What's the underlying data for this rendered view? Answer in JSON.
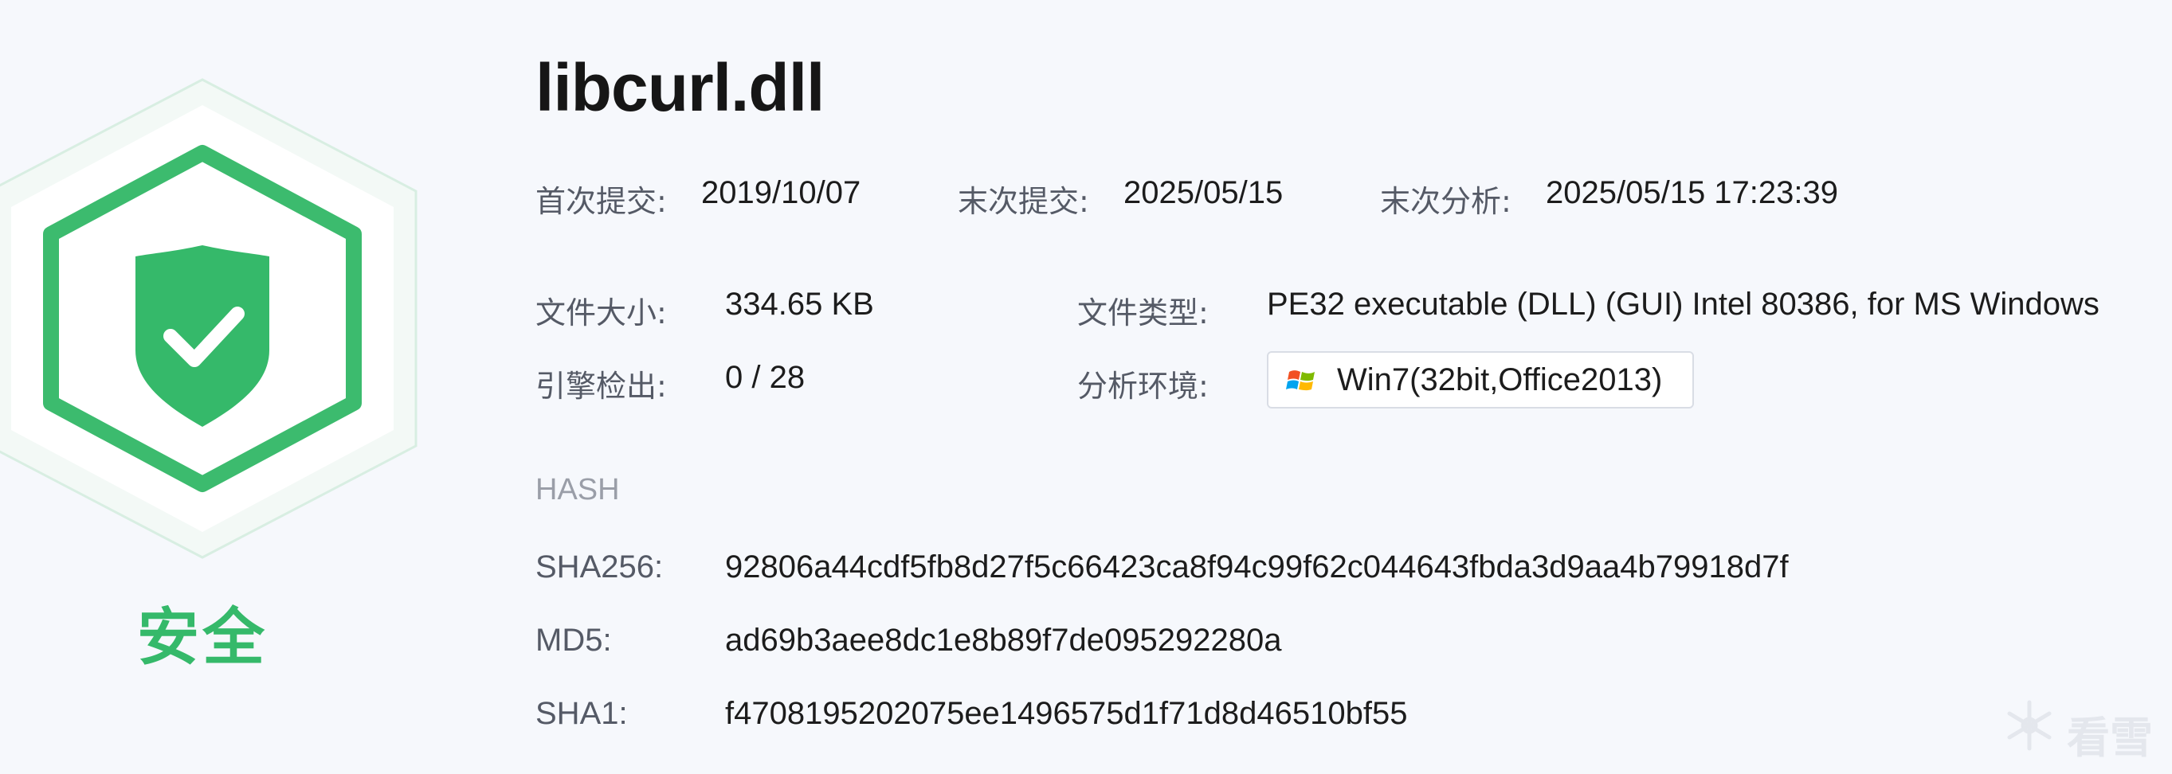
{
  "file": {
    "name": "libcurl.dll",
    "verdict": "安全"
  },
  "submission": {
    "first_label": "首次提交:",
    "first_value": "2019/10/07",
    "last_label": "末次提交:",
    "last_value": "2025/05/15",
    "analysis_label": "末次分析:",
    "analysis_value": "2025/05/15 17:23:39"
  },
  "details": {
    "size_label": "文件大小:",
    "size_value": "334.65 KB",
    "type_label": "文件类型:",
    "type_value": "PE32 executable (DLL) (GUI) Intel 80386, for MS Windows",
    "detect_label": "引擎检出:",
    "detect_value": "0 / 28",
    "env_label": "分析环境:",
    "env_value": "Win7(32bit,Office2013)",
    "env_icon": "windows-logo-icon"
  },
  "hash": {
    "title": "HASH",
    "sha256_label": "SHA256:",
    "sha256_value": "92806a44cdf5fb8d27f5c66423ca8f94c99f62c044643fbda3d9aa4b79918d7f",
    "md5_label": "MD5:",
    "md5_value": "ad69b3aee8dc1e8b89f7de095292280a",
    "sha1_label": "SHA1:",
    "sha1_value": "f4708195202075ee1496575d1f71d8d46510bf55"
  },
  "watermark": {
    "text": "看雪",
    "icon": "snowflake-icon"
  },
  "colors": {
    "safe_green": "#35b96a",
    "background": "#f6f8fc",
    "label_gray": "#555a66",
    "muted_gray": "#9a9ea8"
  }
}
